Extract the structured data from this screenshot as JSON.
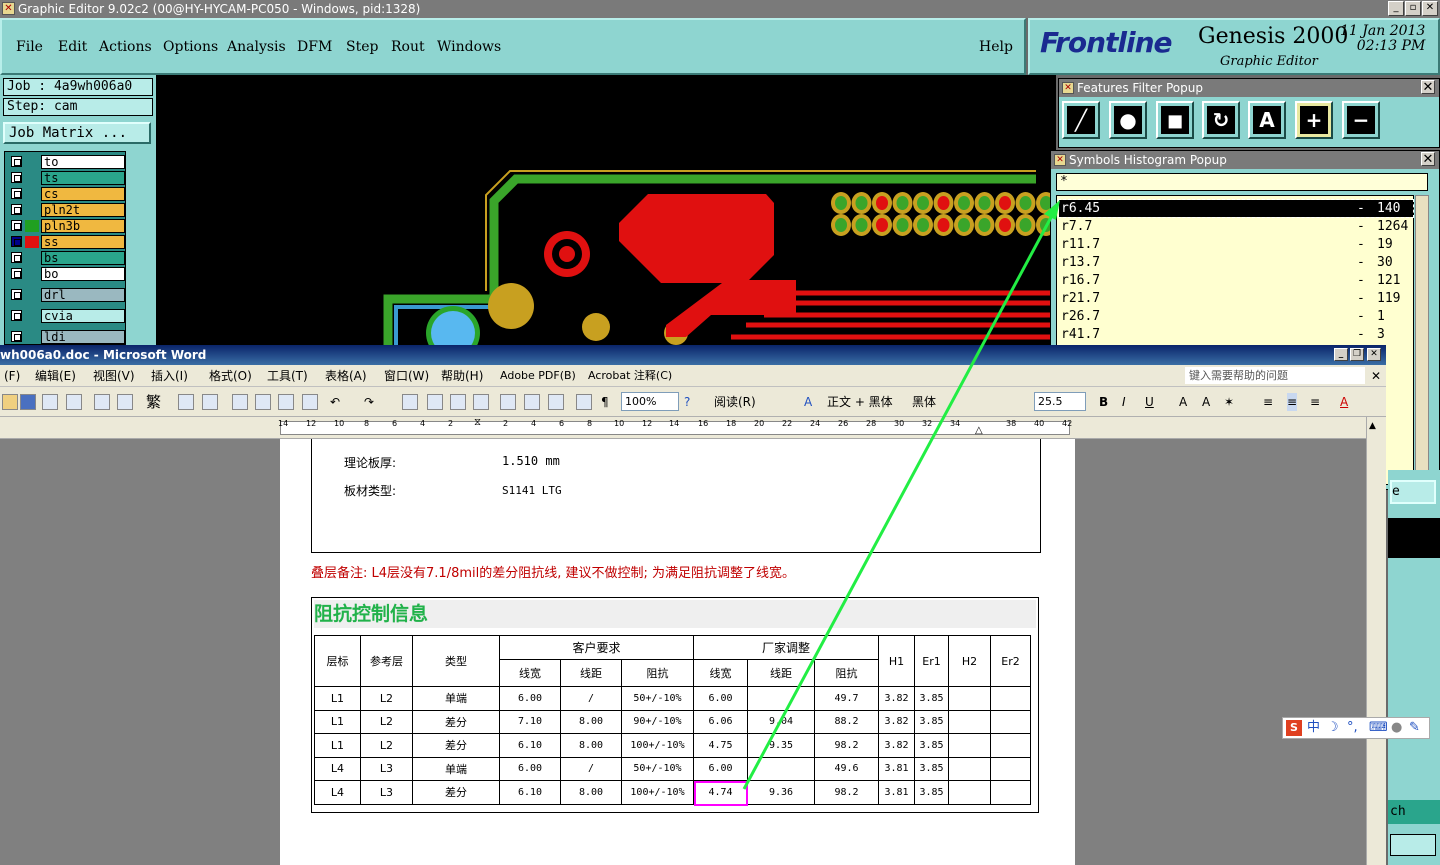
{
  "genesis": {
    "window_title": "Graphic Editor 9.02c2 (00@HY-HYCAM-PC050 - Windows, pid:1328)",
    "menu": [
      "File",
      "Edit",
      "Actions",
      "Options",
      "Analysis",
      "DFM",
      "Step",
      "Rout",
      "Windows"
    ],
    "help": "Help",
    "logo": "Frontline",
    "product": "Genesis 2000",
    "subtitle": "Graphic Editor",
    "date": "11 Jan 2013",
    "time": "02:13 PM",
    "job": "Job : 4a9wh006a0",
    "step": "Step: cam",
    "job_matrix": "Job Matrix ...",
    "layers": [
      {
        "name": "to",
        "color": "#ffffff"
      },
      {
        "name": "ts",
        "color": "#2aa58c"
      },
      {
        "name": "cs",
        "color": "#f0b840"
      },
      {
        "name": "pln2t",
        "color": "#f0b840"
      },
      {
        "name": "pln3b",
        "color": "#f0b840"
      },
      {
        "name": "ss",
        "color": "#f0b840"
      },
      {
        "name": "bs",
        "color": "#2aa58c"
      },
      {
        "name": "bo",
        "color": "#ffffff"
      },
      {
        "name": "drl",
        "color": "#9ab8c0"
      },
      {
        "name": "cvia",
        "color": "#b8ece8"
      },
      {
        "name": "ldi",
        "color": "#9ab8c0"
      }
    ],
    "features_filter_title": "Features Filter Popup",
    "histogram_title": "Symbols Histogram Popup",
    "histogram_filter": "*",
    "histogram": [
      {
        "symbol": "r6.45",
        "count": "140"
      },
      {
        "symbol": "r7.7",
        "count": "1264"
      },
      {
        "symbol": "r11.7",
        "count": "19"
      },
      {
        "symbol": "r13.7",
        "count": "30"
      },
      {
        "symbol": "r16.7",
        "count": "121"
      },
      {
        "symbol": "r21.7",
        "count": "119"
      },
      {
        "symbol": "r26.7",
        "count": "1"
      },
      {
        "symbol": "r41.7",
        "count": "3"
      }
    ],
    "right_fragment_1": "e",
    "right_fragment_2": "ch"
  },
  "word": {
    "title": "wh006a0.doc - Microsoft Word",
    "menu": [
      "(F)",
      "编辑(E)",
      "视图(V)",
      "插入(I)",
      "格式(O)",
      "工具(T)",
      "表格(A)",
      "窗口(W)",
      "帮助(H)",
      "Adobe PDF(B)",
      "Acrobat 注释(C)"
    ],
    "help_placeholder": "键入需要帮助的问题",
    "zoom": "100%",
    "read": "阅读(R)",
    "style": "正文 + 黑体",
    "font": "黑体",
    "size": "25.5",
    "ruler": [
      "14",
      "12",
      "10",
      "8",
      "6",
      "4",
      "2",
      "2",
      "4",
      "6",
      "8",
      "10",
      "12",
      "14",
      "16",
      "18",
      "20",
      "22",
      "24",
      "26",
      "28",
      "30",
      "32",
      "34",
      "38",
      "40",
      "42"
    ],
    "thickness_label": "理论板厚:",
    "thickness_value": "1.510 mm",
    "material_label": "板材类型:",
    "material_value": "S1141  LTG",
    "note": "叠层备注:  L4层没有7.1/8mil的差分阻抗线, 建议不做控制; 为满足阻抗调整了线宽。",
    "impedance_title": "阻抗控制信息",
    "table": {
      "h_layer": "层标",
      "h_ref": "参考层",
      "h_type": "类型",
      "h_customer": "客户要求",
      "h_factory": "厂家调整",
      "h_h1": "H1",
      "h_er1": "Er1",
      "h_h2": "H2",
      "h_er2": "Er2",
      "sub": [
        "线宽",
        "线距",
        "阻抗",
        "线宽",
        "线距",
        "阻抗"
      ],
      "rows": [
        [
          "L1",
          "L2",
          "单端",
          "6.00",
          "/",
          "50+/-10%",
          "6.00",
          "",
          "49.7",
          "3.82",
          "3.85",
          "",
          ""
        ],
        [
          "L1",
          "L2",
          "差分",
          "7.10",
          "8.00",
          "90+/-10%",
          "6.06",
          "9.04",
          "88.2",
          "3.82",
          "3.85",
          "",
          ""
        ],
        [
          "L1",
          "L2",
          "差分",
          "6.10",
          "8.00",
          "100+/-10%",
          "4.75",
          "9.35",
          "98.2",
          "3.82",
          "3.85",
          "",
          ""
        ],
        [
          "L4",
          "L3",
          "单端",
          "6.00",
          "/",
          "50+/-10%",
          "6.00",
          "",
          "49.6",
          "3.81",
          "3.85",
          "",
          ""
        ],
        [
          "L4",
          "L3",
          "差分",
          "6.10",
          "8.00",
          "100+/-10%",
          "4.74",
          "9.36",
          "98.2",
          "3.81",
          "3.85",
          "",
          ""
        ]
      ]
    }
  },
  "ime": {
    "lang": "中"
  },
  "colors": {
    "genesis_bg": "#8ed5d0",
    "arrow": "#22ee44",
    "highlight": "#ff00ff",
    "red_text": "#c00000",
    "green_title": "#21b24a"
  }
}
